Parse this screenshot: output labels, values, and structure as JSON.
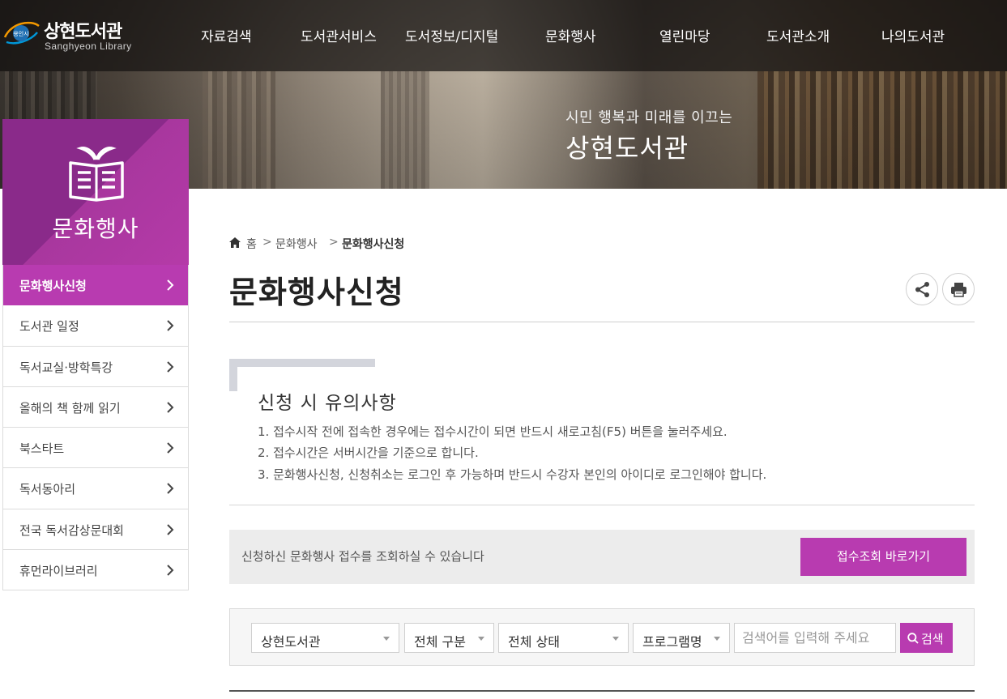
{
  "site": {
    "logo_emblem_text": "용인시",
    "logo_title": "상현도서관",
    "logo_subtitle": "Sanghyeon Library"
  },
  "gnb": {
    "items": [
      "자료검색",
      "도서관서비스",
      "도서정보/디지털",
      "문화행사",
      "열린마당",
      "도서관소개",
      "나의도서관"
    ]
  },
  "hero": {
    "slogan": "시민 행복과 미래를 이끄는",
    "name": "상현도서관"
  },
  "lnb": {
    "title": "문화행사",
    "items": [
      {
        "label": "문화행사신청",
        "active": true
      },
      {
        "label": "도서관 일정",
        "active": false
      },
      {
        "label": "독서교실·방학특강",
        "active": false
      },
      {
        "label": "올해의 책 함께 읽기",
        "active": false
      },
      {
        "label": "북스타트",
        "active": false
      },
      {
        "label": "독서동아리",
        "active": false
      },
      {
        "label": "전국 독서감상문대회",
        "active": false
      },
      {
        "label": "휴먼라이브러리",
        "active": false
      }
    ]
  },
  "breadcrumb": {
    "home": "홈",
    "separator": ">",
    "level1": "문화행사",
    "current": "문화행사신청"
  },
  "page": {
    "title": "문화행사신청",
    "share_icon": "share-icon",
    "print_icon": "print-icon"
  },
  "notice": {
    "title": "신청 시 유의사항",
    "lines": [
      "1. 접수시작 전에 접속한 경우에는 접수시간이 되면 반드시 새로고침(F5) 버튼을 눌러주세요.",
      "2. 접수시간은 서버시간을 기준으로 합니다.",
      "3. 문화행사신청, 신청취소는 로그인 후 가능하며 반드시 수강자 본인의 아이디로 로그인해야 합니다."
    ]
  },
  "lookup": {
    "text": "신청하신 문화행사 접수를 조회하실 수 있습니다",
    "button": "접수조회 바로가기"
  },
  "search": {
    "library": "상현도서관",
    "category": "전체 구분",
    "status": "전체 상태",
    "field": "프로그램명",
    "placeholder": "검색어를 입력해 주세요",
    "button": "검색"
  },
  "colors": {
    "accent": "#b83bb0",
    "accent_dark": "#8a2a8a",
    "nav_bg": "#1a1816"
  }
}
